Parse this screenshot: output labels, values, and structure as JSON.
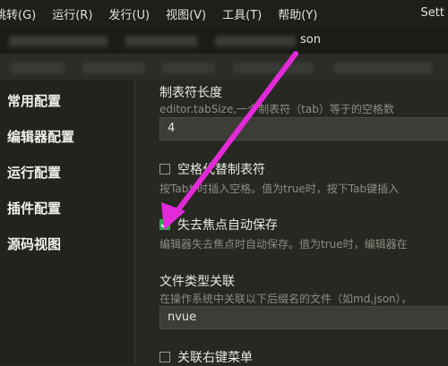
{
  "menu": {
    "items": [
      "跳转(G)",
      "运行(R)",
      "发行(U)",
      "视图(V)",
      "工具(T)",
      "帮助(Y)"
    ],
    "title_fragment": "Sett"
  },
  "tabbar": {
    "label_fragment": "son"
  },
  "sidebar": {
    "items": [
      "常用配置",
      "编辑器配置",
      "运行配置",
      "插件配置",
      "源码视图"
    ]
  },
  "settings": {
    "tab_size": {
      "label": "制表符长度",
      "desc": "editor.tabSize,一个制表符（tab）等于的空格数",
      "value": "4"
    },
    "insert_spaces": {
      "label": "空格代替制表符",
      "desc": "按Tab* 时插入空格。值为true时，按下Tab键插入",
      "checked": false
    },
    "auto_save": {
      "label": "失去焦点自动保存",
      "desc": "编辑器失去焦点时自动保存。值为true时，编辑器在",
      "checked": true
    },
    "file_assoc": {
      "label": "文件类型关联",
      "desc": "在操作系统中关联以下后缀名的文件（如md,json），",
      "value": "nvue"
    },
    "context_menu": {
      "label": "关联右键菜单",
      "checked": false
    }
  },
  "colors": {
    "accent": "#e22ad8",
    "check": "#2ea44f"
  }
}
